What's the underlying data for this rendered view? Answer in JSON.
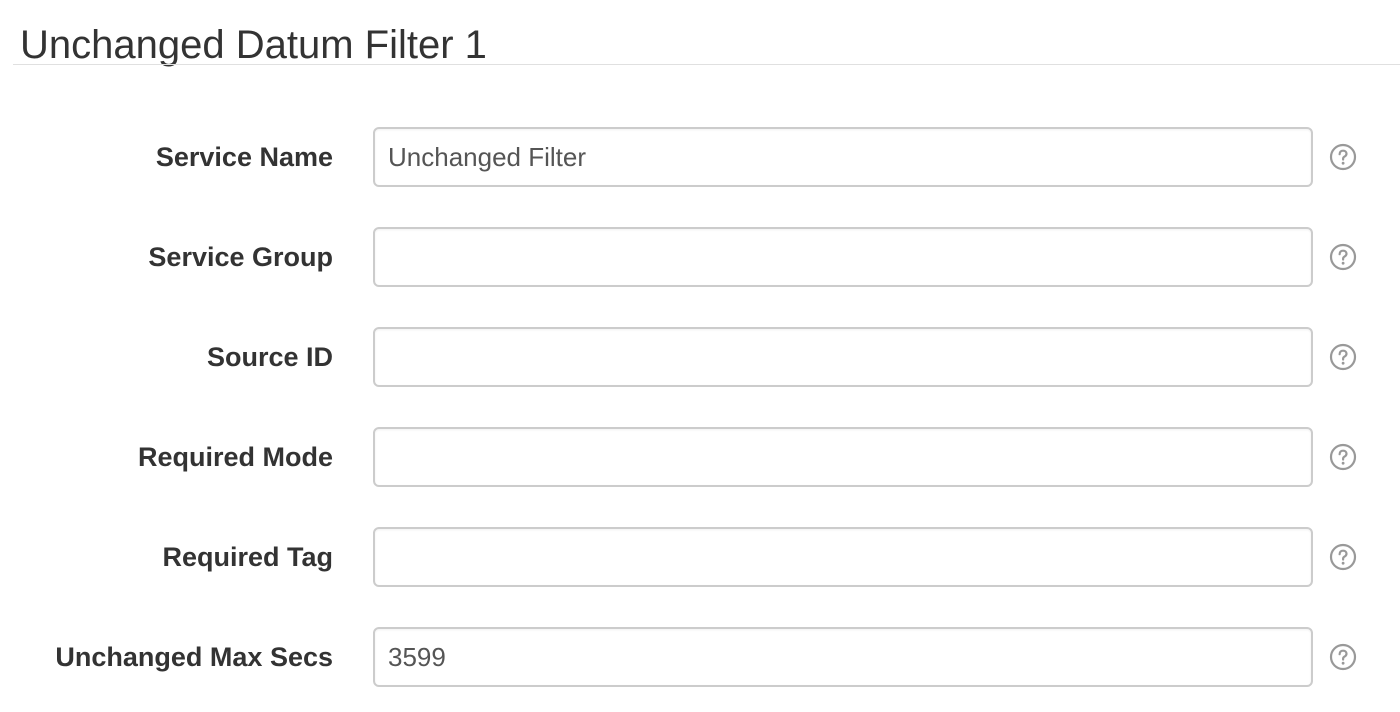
{
  "header": {
    "title": "Unchanged Datum Filter 1"
  },
  "form": {
    "fields": [
      {
        "label": "Service Name",
        "value": "Unchanged Filter",
        "help_icon": "question-circle-icon"
      },
      {
        "label": "Service Group",
        "value": "",
        "help_icon": "question-circle-icon"
      },
      {
        "label": "Source ID",
        "value": "",
        "help_icon": "question-circle-icon"
      },
      {
        "label": "Required Mode",
        "value": "",
        "help_icon": "question-circle-icon"
      },
      {
        "label": "Required Tag",
        "value": "",
        "help_icon": "question-circle-icon"
      },
      {
        "label": "Unchanged Max Secs",
        "value": "3599",
        "help_icon": "question-circle-icon"
      }
    ]
  },
  "colors": {
    "text": "#333333",
    "input_border": "#cccccc",
    "input_text": "#555555",
    "help_icon": "#999999",
    "rule": "#e0e0e0"
  }
}
